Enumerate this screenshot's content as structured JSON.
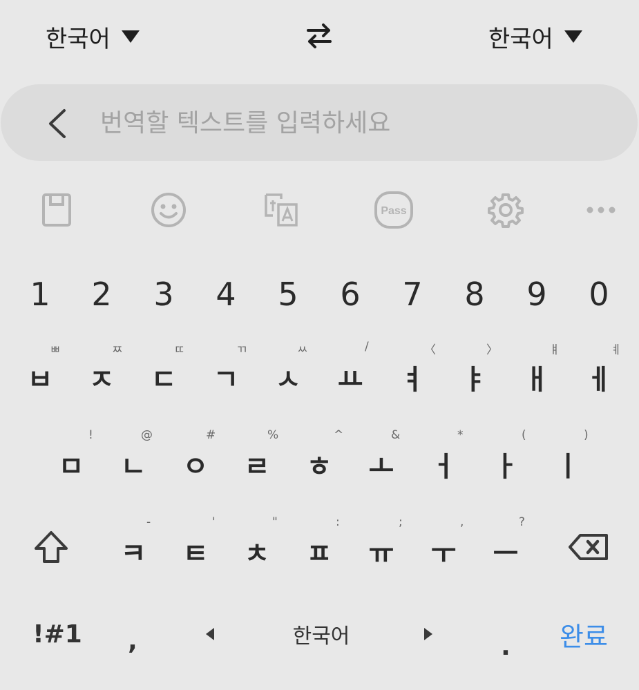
{
  "lang_bar": {
    "source_lang": "한국어",
    "target_lang": "한국어"
  },
  "search": {
    "placeholder": "번역할 텍스트를 입력하세요"
  },
  "toolbar": {
    "icons": [
      "clipboard-icon",
      "emoji-icon",
      "translate-icon",
      "pass-icon",
      "gear-icon",
      "more-icon"
    ],
    "pass_label": "Pass"
  },
  "keyboard": {
    "numbers": [
      "1",
      "2",
      "3",
      "4",
      "5",
      "6",
      "7",
      "8",
      "9",
      "0"
    ],
    "row1": {
      "keys": [
        "ㅂ",
        "ㅈ",
        "ㄷ",
        "ㄱ",
        "ㅅ",
        "ㅛ",
        "ㅕ",
        "ㅑ",
        "ㅐ",
        "ㅔ"
      ],
      "hints": [
        "ㅃ",
        "ㅉ",
        "ㄸ",
        "ㄲ",
        "ㅆ",
        "/",
        "〈",
        "〉",
        "ㅒ",
        "ㅖ"
      ]
    },
    "row2": {
      "keys": [
        "ㅁ",
        "ㄴ",
        "ㅇ",
        "ㄹ",
        "ㅎ",
        "ㅗ",
        "ㅓ",
        "ㅏ",
        "ㅣ"
      ],
      "hints": [
        "!",
        "@",
        "#",
        "%",
        "^",
        "&",
        "*",
        "(",
        ")"
      ]
    },
    "row3": {
      "keys": [
        "ㅋ",
        "ㅌ",
        "ㅊ",
        "ㅍ",
        "ㅠ",
        "ㅜ",
        "ㅡ"
      ],
      "hints": [
        "-",
        "'",
        "\"",
        ":",
        ";",
        ",",
        "?"
      ]
    },
    "bottom": {
      "symbols": "!#1",
      "comma": ",",
      "space_lang": "한국어",
      "period": ".",
      "done": "완료"
    }
  },
  "colors": {
    "background": "#e8e8e8",
    "search_bg": "#dcdcdc",
    "accent": "#3c8de8",
    "icon_gray": "#b4b4b4"
  }
}
